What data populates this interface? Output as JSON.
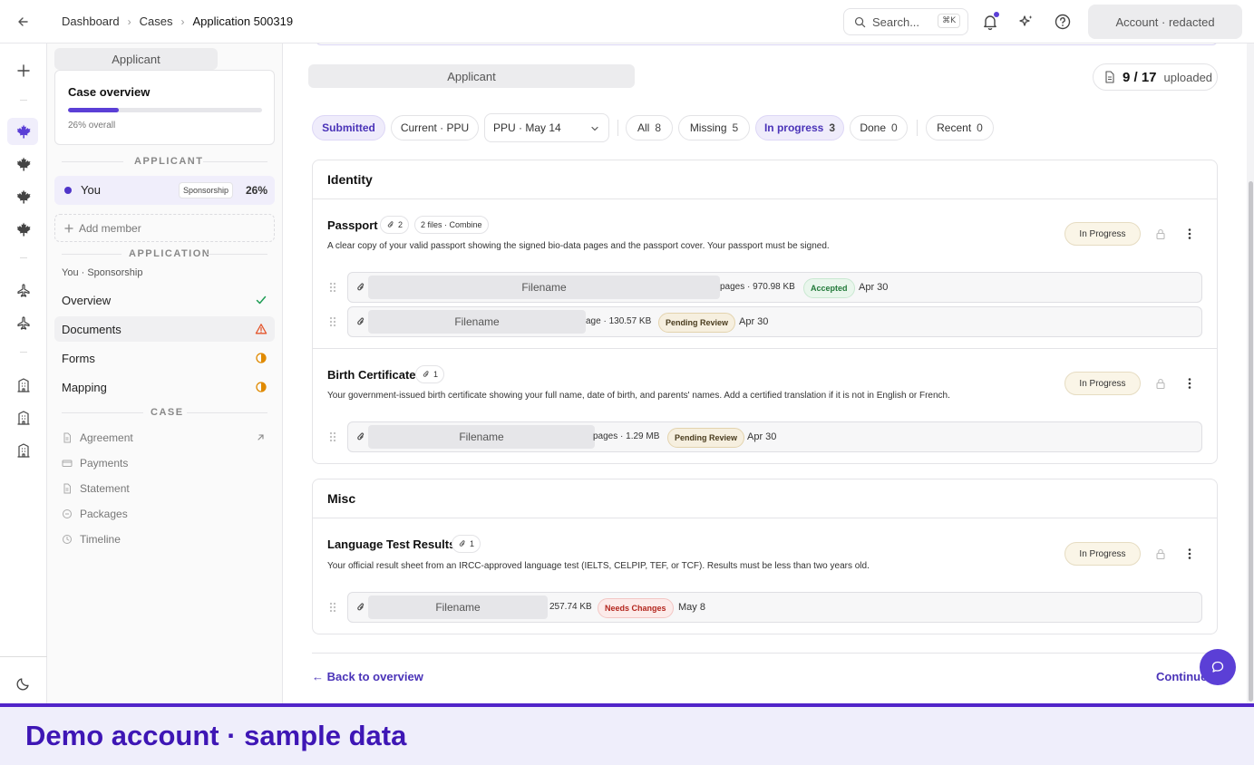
{
  "header": {
    "breadcrumbs": [
      "Dashboard",
      "Cases",
      "Application 500319"
    ],
    "search_placeholder": "Search...",
    "search_shortcut": "⌘K",
    "account_label": "Account · redacted"
  },
  "sidebar": {
    "applicant_pill": "Applicant",
    "case_overview": {
      "title": "Case overview",
      "progress": 0.26,
      "progress_label": "26% overall"
    },
    "applicant_section": "APPLICANT",
    "member": {
      "name": "You",
      "badge": "Sponsorship",
      "percent": "26%"
    },
    "add_member": "Add member",
    "application_section": "APPLICATION",
    "application_subtitle": "You · Sponsorship",
    "nav": [
      {
        "label": "Overview",
        "status": "complete"
      },
      {
        "label": "Documents",
        "status": "warning"
      },
      {
        "label": "Forms",
        "status": "partial"
      },
      {
        "label": "Mapping",
        "status": "partial"
      }
    ],
    "case_section": "CASE",
    "case_items": [
      {
        "label": "Agreement",
        "icon": "file-icon",
        "external": true
      },
      {
        "label": "Payments",
        "icon": "card-icon"
      },
      {
        "label": "Statement",
        "icon": "file-icon"
      },
      {
        "label": "Packages",
        "icon": "package-icon"
      },
      {
        "label": "Timeline",
        "icon": "clock-icon"
      }
    ]
  },
  "main": {
    "applicant_pill": "Applicant",
    "uploaded": {
      "count": "9 / 17",
      "label": "uploaded"
    },
    "filters": {
      "submitted": "Submitted",
      "current": "Current · PPU",
      "select": "PPU · May 14",
      "tabs": [
        {
          "label": "All",
          "count": "8"
        },
        {
          "label": "Missing",
          "count": "5"
        },
        {
          "label": "In progress",
          "count": "3"
        },
        {
          "label": "Done",
          "count": "0"
        },
        {
          "label": "Recent",
          "count": "0"
        }
      ]
    },
    "sections": [
      {
        "title": "Identity",
        "docs": [
          {
            "title": "Passport",
            "attach_count": "2",
            "extra_badge": "2 files · Combine",
            "description": "A clear copy of your valid passport showing the signed bio-data pages and the passport cover. Your passport must be signed.",
            "status": "In Progress",
            "files": [
              {
                "name": "Filename",
                "meta": "pages · 970.98 KB",
                "status": "Accepted",
                "date": "Apr 30"
              },
              {
                "name": "Filename",
                "meta": "age · 130.57 KB",
                "status": "Pending Review",
                "date": "Apr 30"
              }
            ]
          },
          {
            "title": "Birth Certificate",
            "attach_count": "1",
            "description": "Your government-issued birth certificate showing your full name, date of birth, and parents' names. Add a certified translation if it is not in English or French.",
            "status": "In Progress",
            "files": [
              {
                "name": "Filename",
                "meta": "pages · 1.29 MB",
                "status": "Pending Review",
                "date": "Apr 30"
              }
            ]
          }
        ]
      },
      {
        "title": "Misc",
        "docs": [
          {
            "title": "Language Test Results",
            "attach_count": "1",
            "description": "Your official result sheet from an IRCC-approved language test (IELTS, CELPIP, TEF, or TCF). Results must be less than two years old.",
            "status": "In Progress",
            "files": [
              {
                "name": "Filename",
                "meta": "257.74 KB",
                "status": "Needs Changes",
                "date": "May 8"
              }
            ]
          }
        ]
      }
    ],
    "back_link": "← Back to overview",
    "continue_link": "Continue"
  },
  "banner": "Demo account · sample data",
  "colors": {
    "accent": "#5b3fd6",
    "accent_dark": "#4a33b8",
    "banner_text": "#3e16b5"
  }
}
